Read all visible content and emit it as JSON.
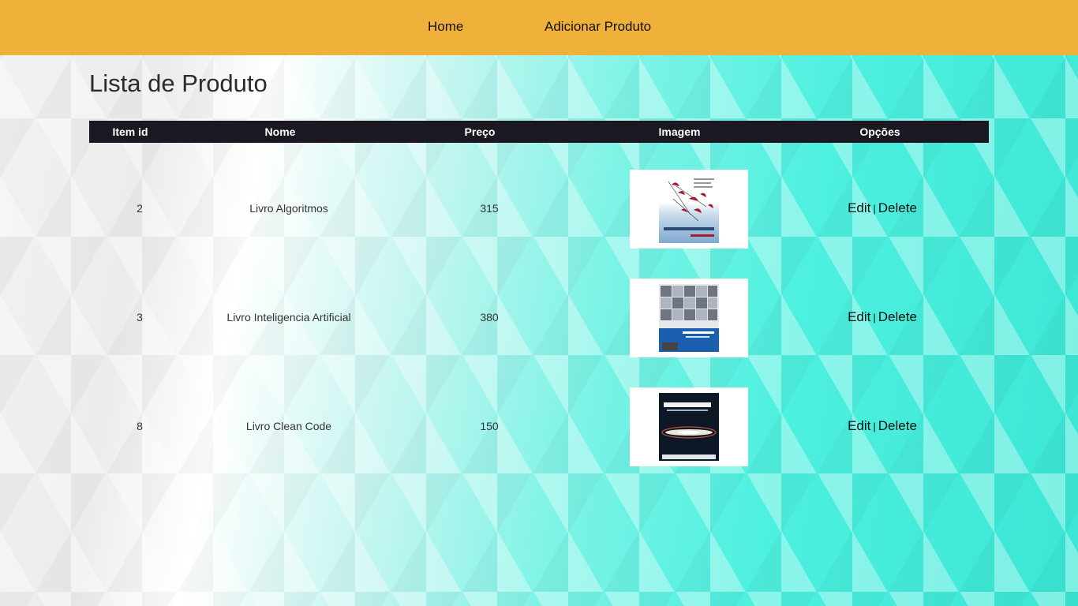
{
  "nav": {
    "home_label": "Home",
    "add_label": "Adicionar Produto"
  },
  "page": {
    "title": "Lista de Produto"
  },
  "table": {
    "columns": [
      "Item id",
      "Nome",
      "Preço",
      "Imagem",
      "Opções"
    ],
    "rows": [
      {
        "id": "2",
        "nome": "Livro Algoritmos",
        "preco": "315",
        "cover": "algoritmos-book-cover",
        "edit": "Edit",
        "sep": "|",
        "delete": "Delete"
      },
      {
        "id": "3",
        "nome": "Livro Inteligencia Artificial",
        "preco": "380",
        "cover": "inteligencia-artificial-book-cover",
        "edit": "Edit",
        "sep": "|",
        "delete": "Delete"
      },
      {
        "id": "8",
        "nome": "Livro Clean Code",
        "preco": "150",
        "cover": "codigo-limpo-book-cover",
        "edit": "Edit",
        "sep": "|",
        "delete": "Delete"
      }
    ]
  },
  "colors": {
    "navbar": "#f0b13a",
    "table_header": "#1c1822"
  }
}
